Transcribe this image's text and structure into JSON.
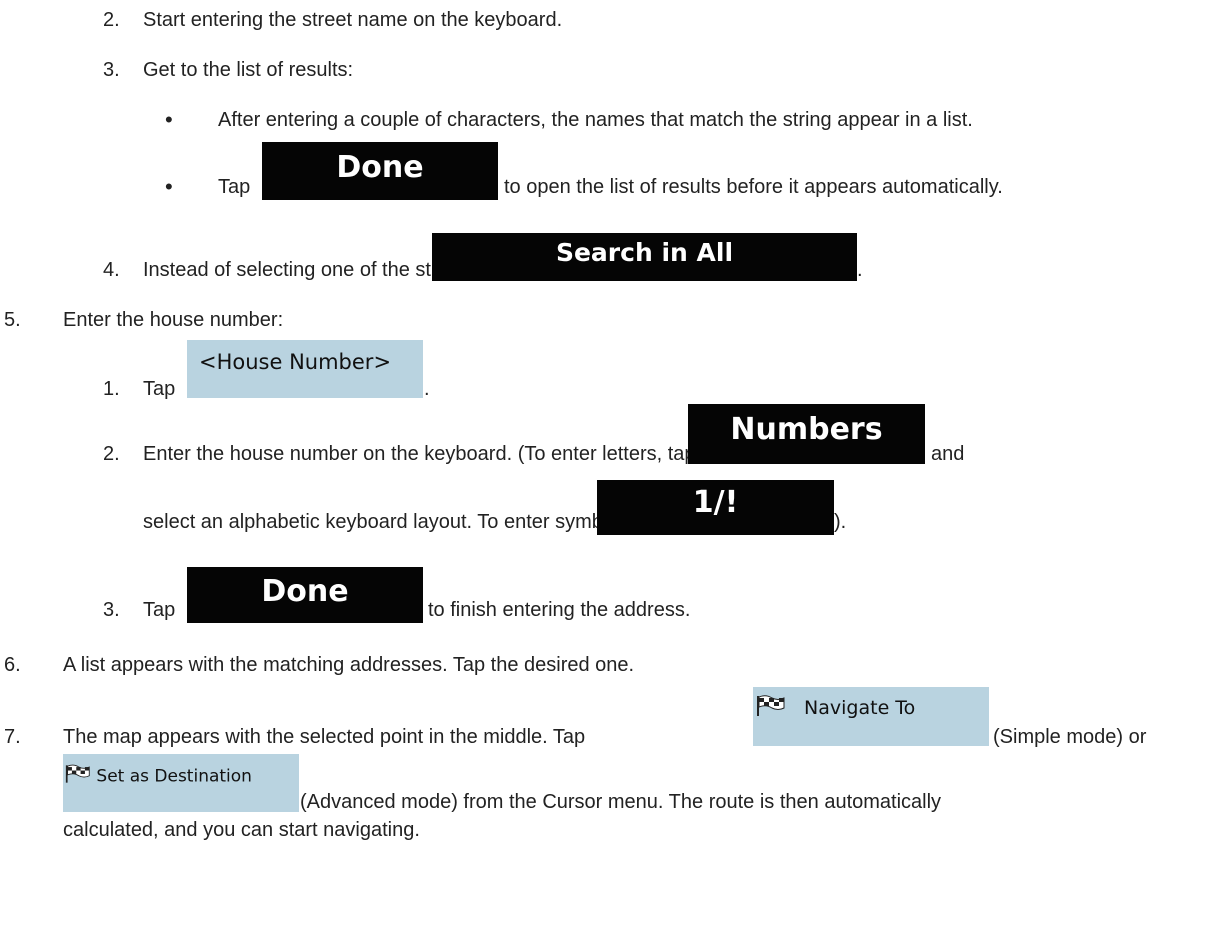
{
  "steps": {
    "s2_num": "2.",
    "s2_text": "Start entering the street name on the keyboard.",
    "s3_num": "3.",
    "s3_text": "Get to the list of results:",
    "b1_text": "After entering a couple of characters, the names that match the string appear in a list.",
    "b2_pre": "Tap",
    "b2_post": "to open the list of results before it appears automatically.",
    "s4_num": "4.",
    "s4_text": "Instead of selecting one of the streets, tap",
    "s4_end": ".",
    "s5_num": "5.",
    "s5_text": "Enter the house number:",
    "s5a_num": "1.",
    "s5a_pre": "Tap",
    "s5a_end": ".",
    "s5b_num": "2.",
    "s5b_text": "Enter the house number on the keyboard. (To enter letters, tap",
    "s5b_and": "and",
    "s5b_line2": "select an alphabetic keyboard layout. To enter symbols, tap",
    "s5b_end": ").",
    "s5c_num": "3.",
    "s5c_pre": "Tap",
    "s5c_post": "to finish entering the address.",
    "s6_num": "6.",
    "s6_text": "A list appears with the matching addresses. Tap the desired one.",
    "s7_num": "7.",
    "s7_text": "The map appears with the selected point in the middle. Tap",
    "s7_mid": "(Simple mode) or",
    "s7_line2": "(Advanced mode) from the Cursor menu. The route is then automatically",
    "s7_line3": "calculated, and you can start navigating."
  },
  "buttons": {
    "done": "Done",
    "search_in_all": "Search in All",
    "house_number": "<House Number>",
    "numbers": "Numbers",
    "symbols": "1/!",
    "navigate_to": "Navigate To",
    "set_as_destination": "Set as Destination"
  }
}
